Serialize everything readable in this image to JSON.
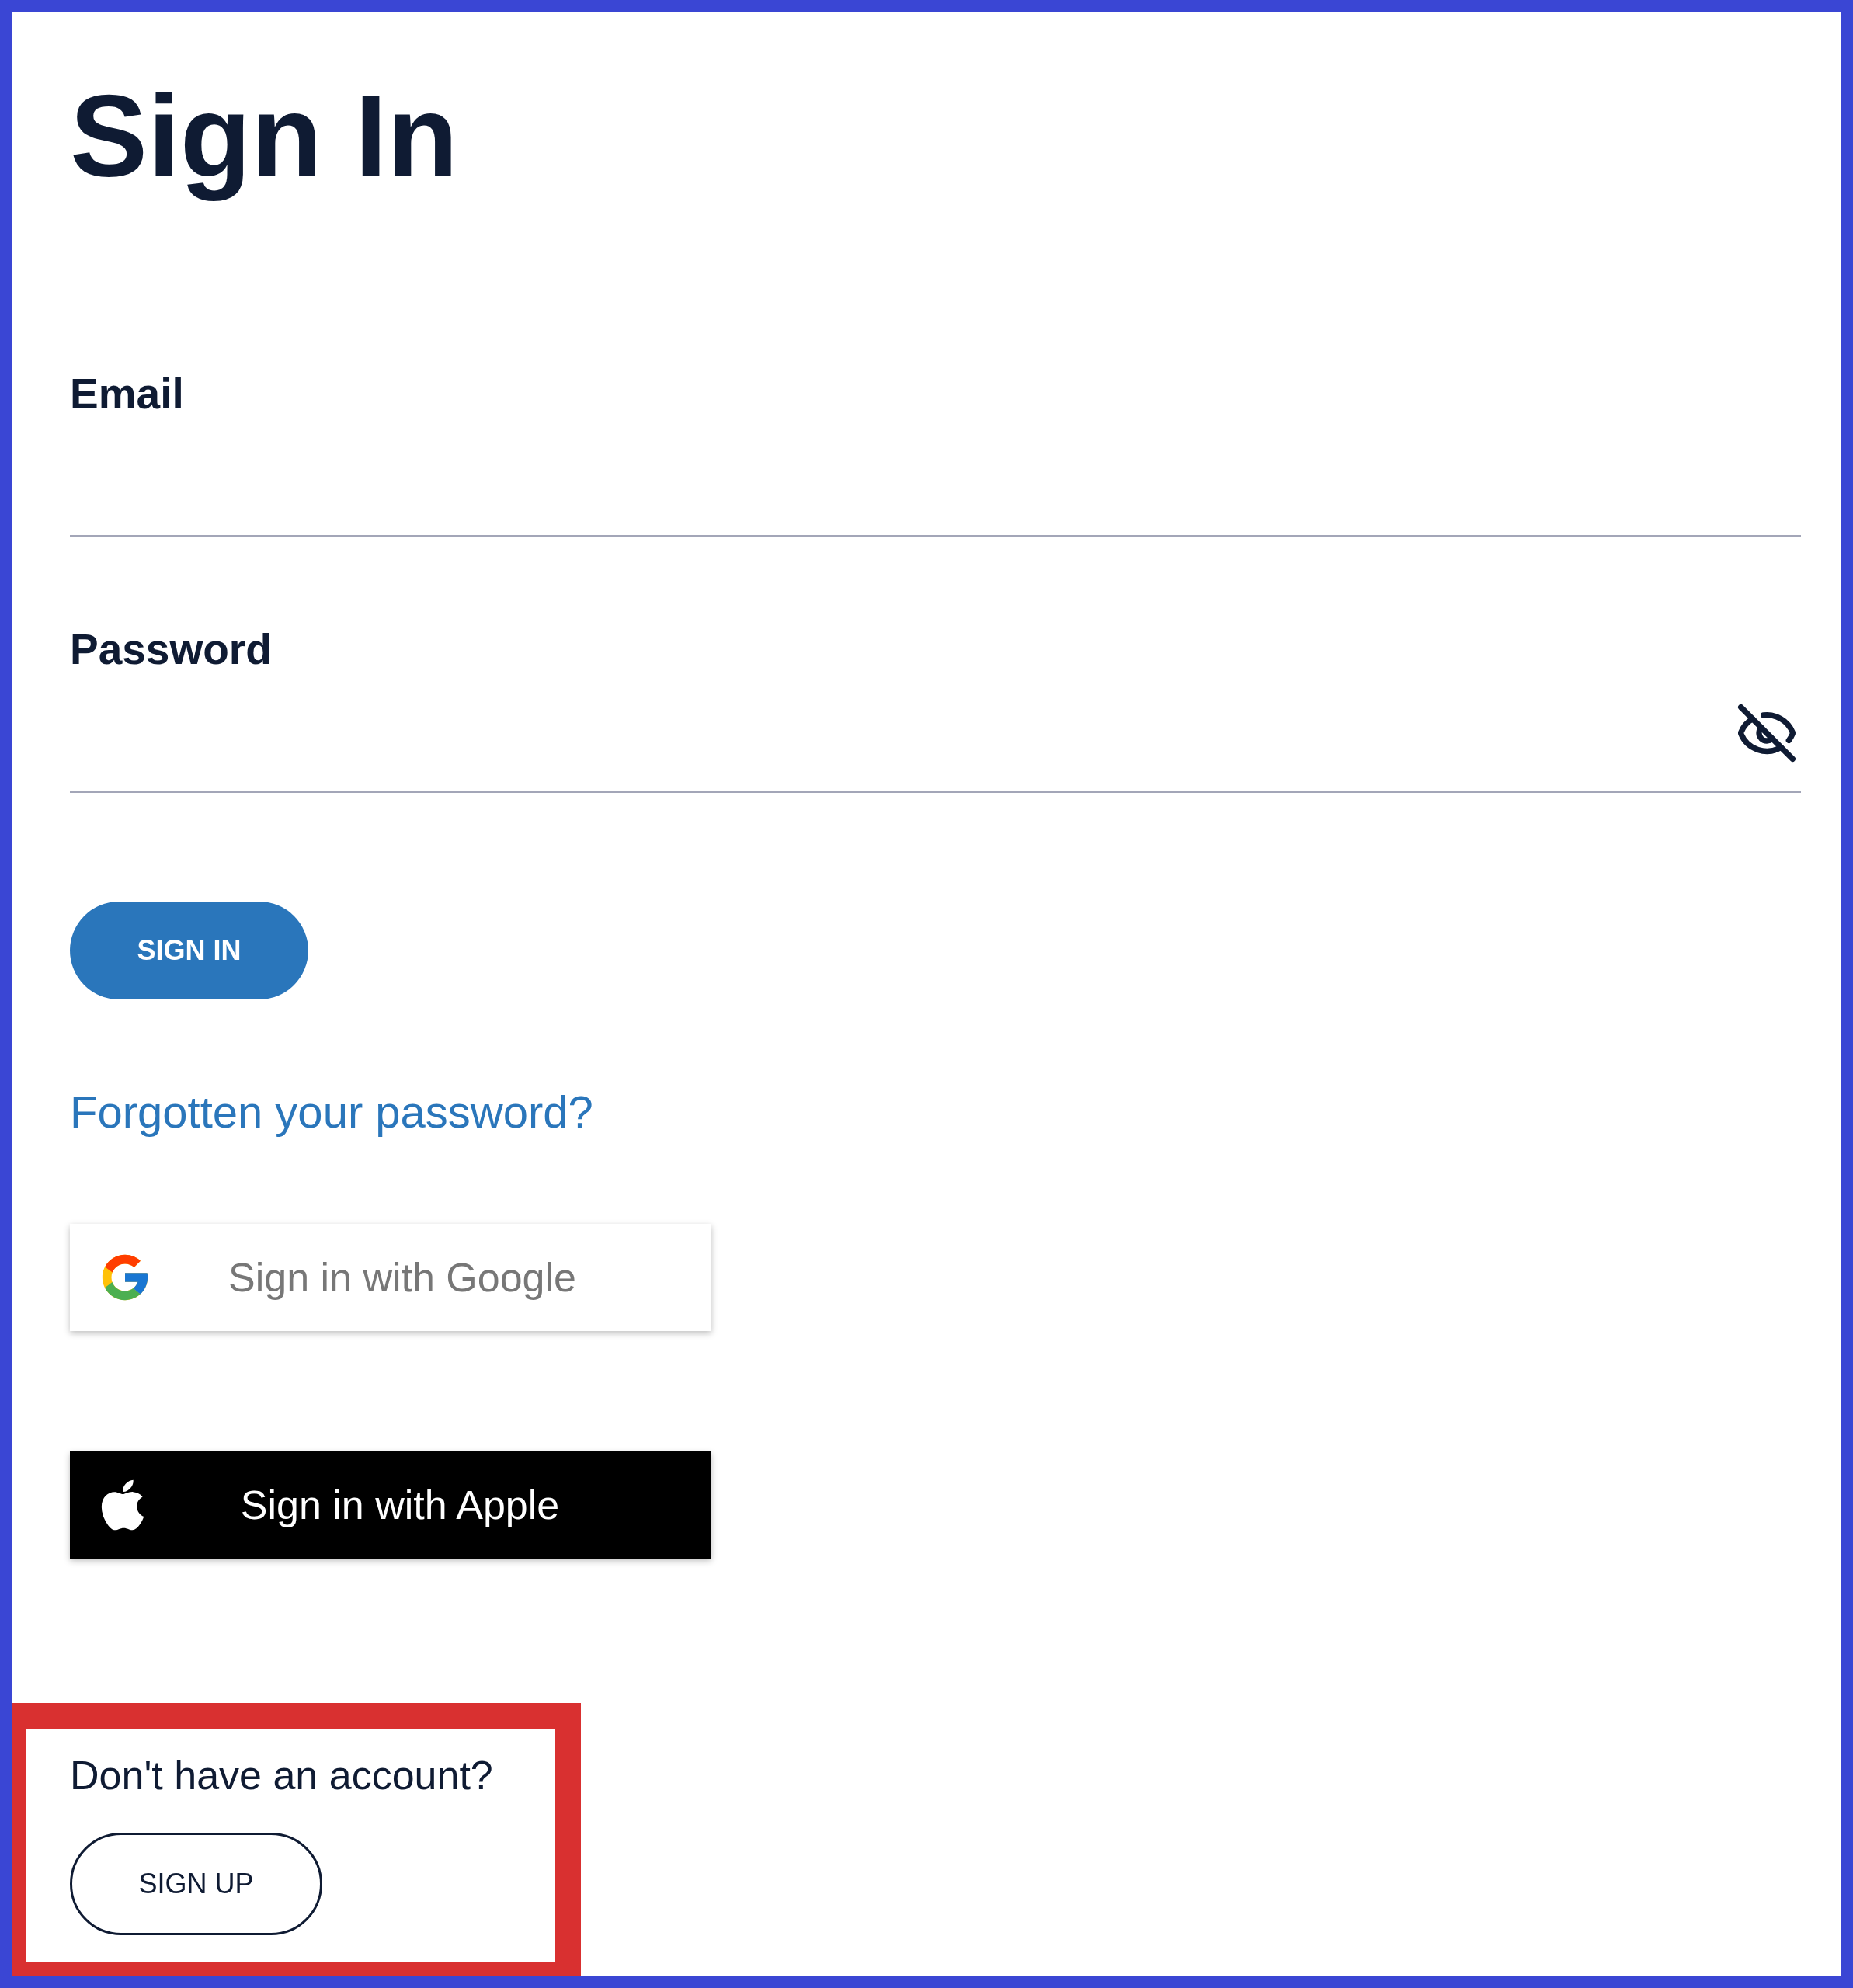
{
  "title": "Sign In",
  "fields": [
    {
      "label": "Email",
      "kind": "text"
    },
    {
      "label": "Password",
      "kind": "password",
      "revealed": false
    }
  ],
  "sign_in_button": "SIGN IN",
  "forgot_link": "Forgotten your password?",
  "social_buttons": [
    {
      "label": "Sign in with Google",
      "kind": "google"
    },
    {
      "label": "Sign in with Apple",
      "kind": "apple"
    }
  ],
  "signup": {
    "prompt": "Don't have an account?",
    "button": "SIGN UP"
  }
}
